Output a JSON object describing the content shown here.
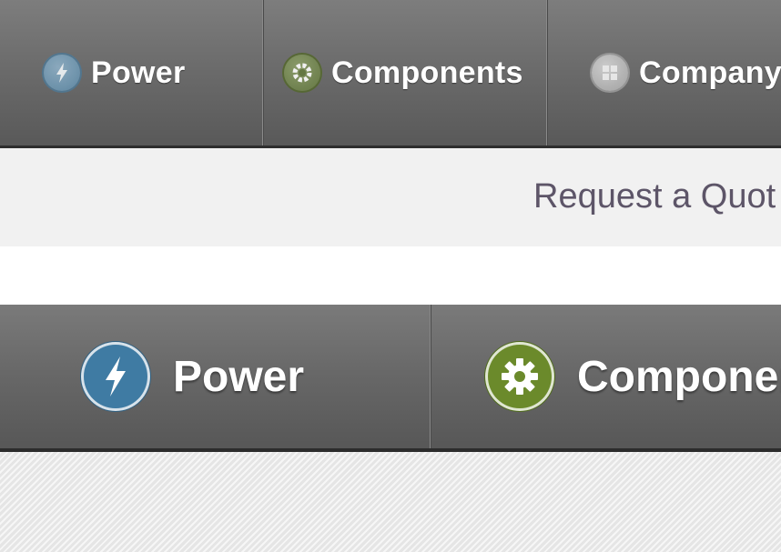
{
  "top_nav": {
    "items": [
      {
        "label": "Power",
        "icon": "lightning-bolt-icon"
      },
      {
        "label": "Components",
        "icon": "gear-icon"
      },
      {
        "label": "Company",
        "icon": "building-icon"
      }
    ]
  },
  "quote_bar": {
    "link_text": "Request a Quot"
  },
  "large_nav": {
    "items": [
      {
        "label": "Power",
        "icon": "lightning-bolt-icon"
      },
      {
        "label": "Componen",
        "icon": "gear-icon"
      }
    ]
  },
  "colors": {
    "nav_bar": "#6a6a6a",
    "power_icon": "#3f7ba3",
    "components_icon": "#6b8a2b",
    "company_icon": "#9a9a9a",
    "quote_text": "#5d5568",
    "quote_bar_bg": "#f1f1f1"
  }
}
